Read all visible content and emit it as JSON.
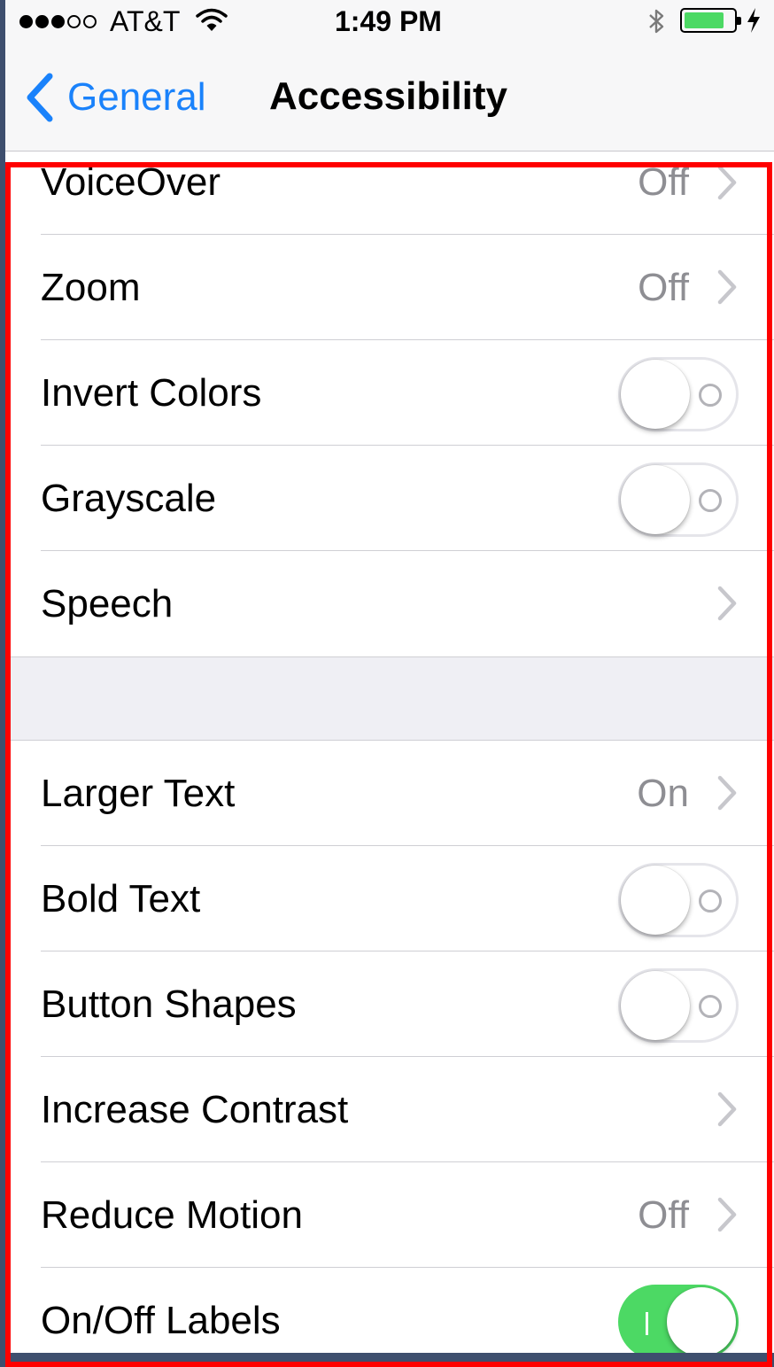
{
  "status_bar": {
    "signal_bars_filled": 3,
    "signal_bars_total": 5,
    "carrier": "AT&T",
    "time": "1:49 PM",
    "battery_level": 0.82,
    "charging": true
  },
  "nav": {
    "back_label": "General",
    "title": "Accessibility"
  },
  "colors": {
    "accent": "#1a82fb",
    "toggle_on": "#4cd964",
    "secondary_text": "#8e8e93",
    "highlight_border": "#ff0000"
  },
  "groups": [
    {
      "rows": [
        {
          "label": "VoiceOver",
          "value": "Off",
          "type": "disclosure"
        },
        {
          "label": "Zoom",
          "value": "Off",
          "type": "disclosure"
        },
        {
          "label": "Invert Colors",
          "type": "toggle",
          "on": false
        },
        {
          "label": "Grayscale",
          "type": "toggle",
          "on": false
        },
        {
          "label": "Speech",
          "value": "",
          "type": "disclosure"
        }
      ]
    },
    {
      "rows": [
        {
          "label": "Larger Text",
          "value": "On",
          "type": "disclosure"
        },
        {
          "label": "Bold Text",
          "type": "toggle",
          "on": false
        },
        {
          "label": "Button Shapes",
          "type": "toggle",
          "on": false
        },
        {
          "label": "Increase Contrast",
          "value": "",
          "type": "disclosure"
        },
        {
          "label": "Reduce Motion",
          "value": "Off",
          "type": "disclosure"
        },
        {
          "label": "On/Off Labels",
          "type": "toggle",
          "on": true
        }
      ]
    }
  ]
}
